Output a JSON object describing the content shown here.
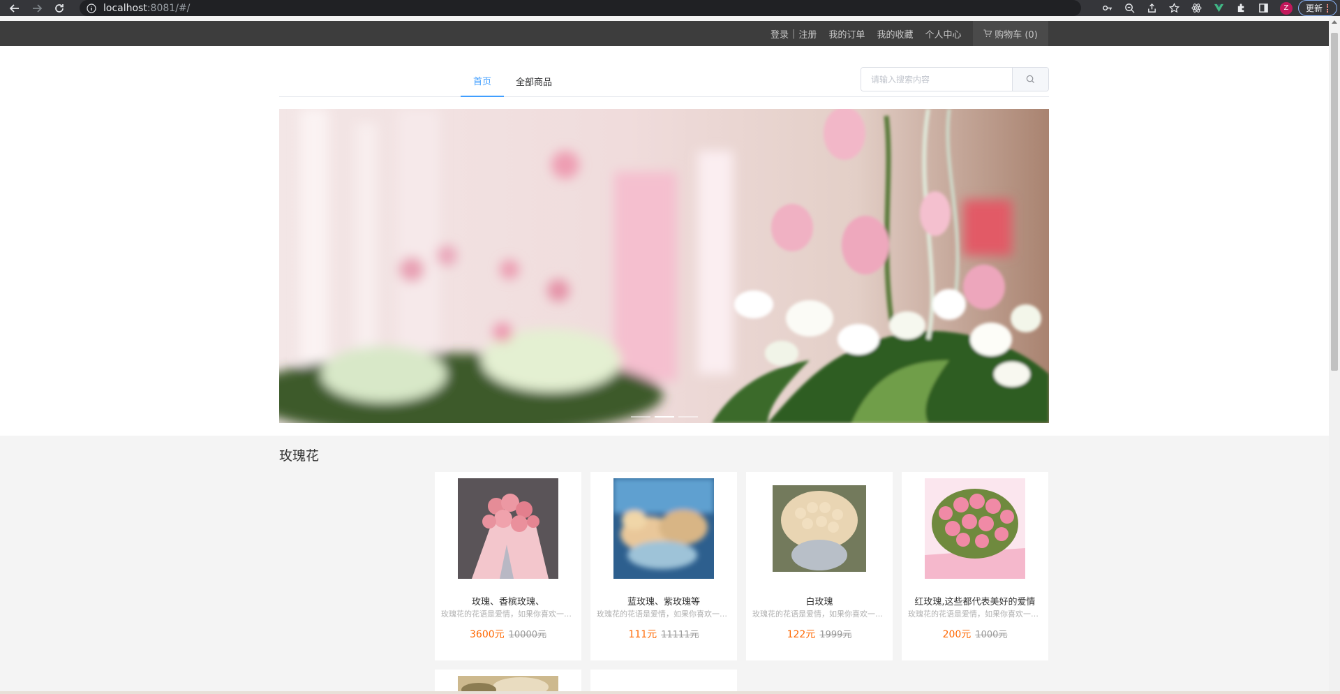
{
  "browser": {
    "url_host": "localhost",
    "url_path": ":8081/#/",
    "update_label": "更新",
    "profile_initial": "Z"
  },
  "topbar": {
    "login": "登录",
    "separator": "|",
    "register": "注册",
    "orders": "我的订单",
    "favorites": "我的收藏",
    "profile": "个人中心",
    "cart": "购物车 (0)"
  },
  "nav": {
    "tabs": [
      {
        "label": "首页",
        "active": true
      },
      {
        "label": "全部商品",
        "active": false
      }
    ],
    "search_placeholder": "请输入搜索内容"
  },
  "carousel": {
    "indicator_count": 3,
    "active_index": 1
  },
  "section": {
    "title": "玫瑰花",
    "products": [
      {
        "name": "玫瑰、香槟玫瑰、",
        "desc": "玫瑰花的花语是爱情，如果你喜欢一个...",
        "price": "3600元",
        "old_price": "10000元",
        "thumb": "pink-bouquet"
      },
      {
        "name": "蓝玫瑰、紫玫瑰等",
        "desc": "玫瑰花的花语是爱情，如果你喜欢一个...",
        "price": "111元",
        "old_price": "11111元",
        "thumb": "blue-roses"
      },
      {
        "name": "白玫瑰",
        "desc": "玫瑰花的花语是爱情，如果你喜欢一个...",
        "price": "122元",
        "old_price": "1999元",
        "thumb": "champagne-bouquet"
      },
      {
        "name": "红玫瑰,这些都代表美好的爱情",
        "desc": "玫瑰花的花语是爱情，如果你喜欢一个...",
        "price": "200元",
        "old_price": "1000元",
        "thumb": "pink-carnations"
      }
    ]
  },
  "colors": {
    "accent": "#409eff",
    "price": "#ff6700",
    "topbar": "#3d3d3d"
  }
}
